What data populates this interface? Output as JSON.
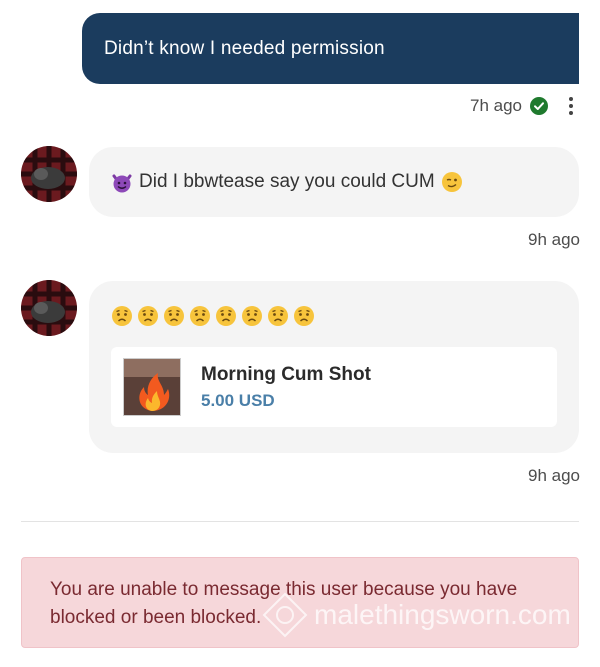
{
  "messages": [
    {
      "direction": "sent",
      "text": "Didn’t know I needed permission",
      "time": "7h ago",
      "status": "read"
    },
    {
      "direction": "received",
      "text": "Did I bbwtease say you could CUM",
      "time": "9h ago",
      "icons": [
        "smiling-devil-emoji",
        "winking-face-emoji"
      ]
    },
    {
      "direction": "received",
      "emoji_count": 8,
      "emoji": "worried-face-emoji",
      "time": "9h ago",
      "product": {
        "title": "Morning Cum Shot",
        "price": "5.00 USD",
        "icon": "fire-emoji"
      }
    }
  ],
  "blocked_notice": "You are unable to message this user because you have blocked or been blocked.",
  "watermark": "malethingsworn.com",
  "colors": {
    "sent_bubble": "#1b3c5e",
    "received_bubble": "#f4f4f4",
    "price": "#4a7fa8",
    "notice_bg": "#f6d7da",
    "notice_text": "#7a2a31",
    "read_check": "#1f7a2e"
  }
}
